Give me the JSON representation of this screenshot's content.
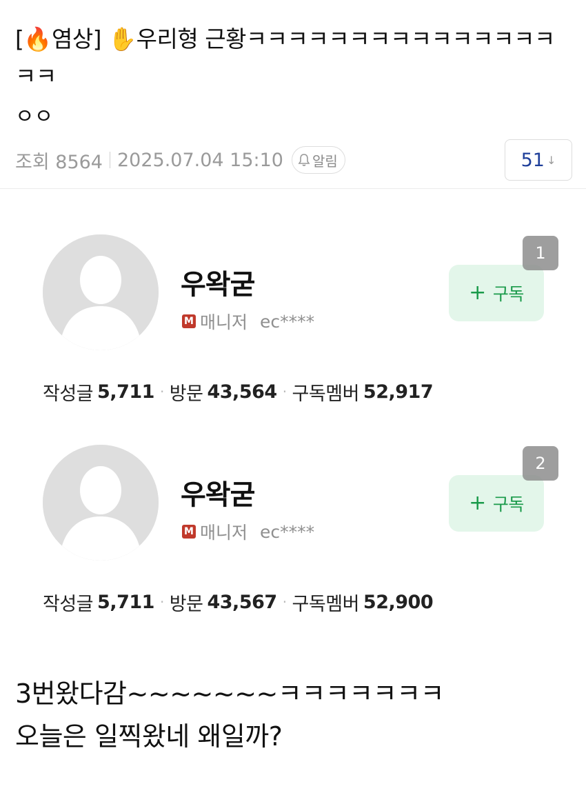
{
  "post": {
    "title": "[🔥염상] ✋우리형 근황ㅋㅋㅋㅋㅋㅋㅋㅋㅋㅋㅋㅋㅋㅋㅋㅋㅋ",
    "author": "ㅇㅇ",
    "views_label": "조회 8564",
    "date": "2025.07.04 15:10",
    "alarm_label": "알림",
    "comment_count": "51",
    "body_lines": [
      "3번왔다감~~~~~~~ㅋㅋㅋㅋㅋㅋㅋ",
      "오늘은 일찍왔네 왜일까?"
    ]
  },
  "profiles": [
    {
      "rank": "1",
      "nickname": "우왁굳",
      "role_badge": "M",
      "role": "매니저",
      "user_id": "ec****",
      "subscribe_label": "구독",
      "stats": {
        "posts_label": "작성글",
        "posts": "5,711",
        "visits_label": "방문",
        "visits": "43,564",
        "members_label": "구독멤버",
        "members": "52,917"
      }
    },
    {
      "rank": "2",
      "nickname": "우왁굳",
      "role_badge": "M",
      "role": "매니저",
      "user_id": "ec****",
      "subscribe_label": "구독",
      "stats": {
        "posts_label": "작성글",
        "posts": "5,711",
        "visits_label": "방문",
        "visits": "43,567",
        "members_label": "구독멤버",
        "members": "52,900"
      }
    }
  ],
  "colors": {
    "subscribe_bg": "#e3f6ea",
    "subscribe_text": "#1a9a4a",
    "comment_count": "#1f3f9a",
    "role_badge": "#c0392b"
  }
}
